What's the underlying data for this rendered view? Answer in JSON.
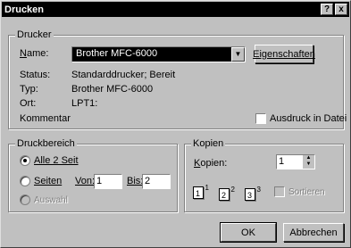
{
  "title": "Drucken",
  "title_buttons": {
    "help": "?",
    "close": "x"
  },
  "drucker": {
    "legend": "Drucker",
    "name_label": "Name:",
    "name_value": "Brother MFC-6000",
    "properties_button": "Eigenschaften",
    "status_label": "Status:",
    "status_value": "Standarddrucker; Bereit",
    "typ_label": "Typ:",
    "typ_value": "Brother MFC-6000",
    "ort_label": "Ort:",
    "ort_value": "LPT1:",
    "kommentar_label": "Kommentar",
    "print_to_file_label": "Ausdruck in Datei"
  },
  "druckbereich": {
    "legend": "Druckbereich",
    "all_label": "Alle 2 Seit",
    "pages_label": "Seiten",
    "von_label": "Von:",
    "von_value": "1",
    "bis_label": "Bis:",
    "bis_value": "2",
    "selection_label": "Auswahl"
  },
  "kopien": {
    "legend": "Kopien",
    "copies_label": "Kopien:",
    "copies_value": "1",
    "collate_label": "Sortieren",
    "pages": [
      {
        "back": "1",
        "front": "1"
      },
      {
        "back": "2",
        "front": "2"
      },
      {
        "back": "3",
        "front": "3"
      }
    ]
  },
  "footer": {
    "ok": "OK",
    "cancel": "Abbrechen"
  }
}
